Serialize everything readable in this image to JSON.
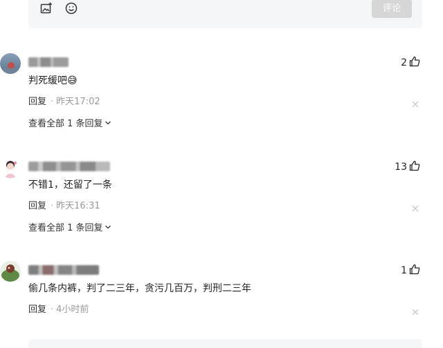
{
  "composer": {
    "image_icon": "image-add-icon",
    "emoji_icon": "smiley-icon",
    "submit_label": "评论"
  },
  "comments": [
    {
      "username": "",
      "likes": "2",
      "text": "判死缓吧",
      "emoji": "😅",
      "reply_label": "回复",
      "separator": "·",
      "time": "昨天17:02",
      "view_replies": "查看全部 1 条回复"
    },
    {
      "username": "",
      "likes": "13",
      "text": "不错1，还留了一条",
      "reply_label": "回复",
      "separator": "·",
      "time": "昨天16:31",
      "view_replies": "查看全部 1 条回复"
    },
    {
      "username": "",
      "likes": "1",
      "text": "偷几条内裤，判了二三年，贪污几百万，判刑二三年",
      "reply_label": "回复",
      "separator": "·",
      "time": "4小时前"
    }
  ],
  "colors": {
    "composer_bg": "#f5f6f7",
    "submit_disabled": "#d6d6d6",
    "text": "#222222",
    "muted": "#999999"
  }
}
